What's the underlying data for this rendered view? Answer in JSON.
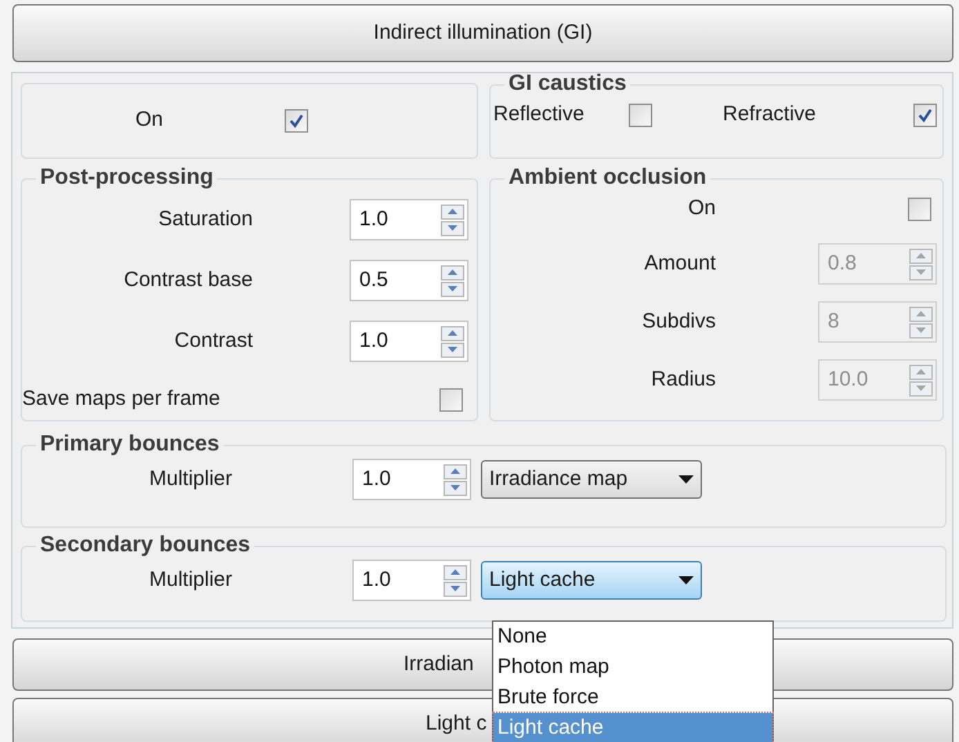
{
  "header_button": "Indirect illumination (GI)",
  "gi": {
    "label": "On",
    "checked": true
  },
  "gi_caustics": {
    "title": "GI caustics",
    "options": [
      {
        "label": "Reflective",
        "checked": false
      },
      {
        "label": "Refractive",
        "checked": true
      }
    ]
  },
  "post_processing": {
    "title": "Post-processing",
    "rows": [
      {
        "kind": "spinner",
        "label": "Saturation",
        "value": "1.0",
        "disabled": false
      },
      {
        "kind": "spinner",
        "label": "Contrast base",
        "value": "0.5",
        "disabled": false
      },
      {
        "kind": "spinner",
        "label": "Contrast",
        "value": "1.0",
        "disabled": false
      },
      {
        "kind": "checkbox",
        "label": "Save maps per frame",
        "checked": false
      }
    ]
  },
  "ambient_occlusion": {
    "title": "Ambient occlusion",
    "rows": [
      {
        "kind": "checkbox",
        "label": "On",
        "checked": false
      },
      {
        "kind": "spinner",
        "label": "Amount",
        "value": "0.8",
        "disabled": true
      },
      {
        "kind": "spinner",
        "label": "Subdivs",
        "value": "8",
        "disabled": true
      },
      {
        "kind": "spinner",
        "label": "Radius",
        "value": "10.0",
        "disabled": true
      }
    ]
  },
  "bounces": [
    {
      "title": "Primary bounces",
      "label": "Multiplier",
      "value": "1.0",
      "engine": "Irradiance map",
      "focused": false
    },
    {
      "title": "Secondary bounces",
      "label": "Multiplier",
      "value": "1.0",
      "engine": "Light cache",
      "focused": true
    }
  ],
  "dropdown_list": {
    "items": [
      {
        "label": "None",
        "selected": false
      },
      {
        "label": "Photon map",
        "selected": false
      },
      {
        "label": "Brute force",
        "selected": false
      },
      {
        "label": "Light cache",
        "selected": true
      }
    ]
  },
  "rollouts": [
    {
      "label": "Irradian"
    },
    {
      "label": "Light c"
    }
  ]
}
